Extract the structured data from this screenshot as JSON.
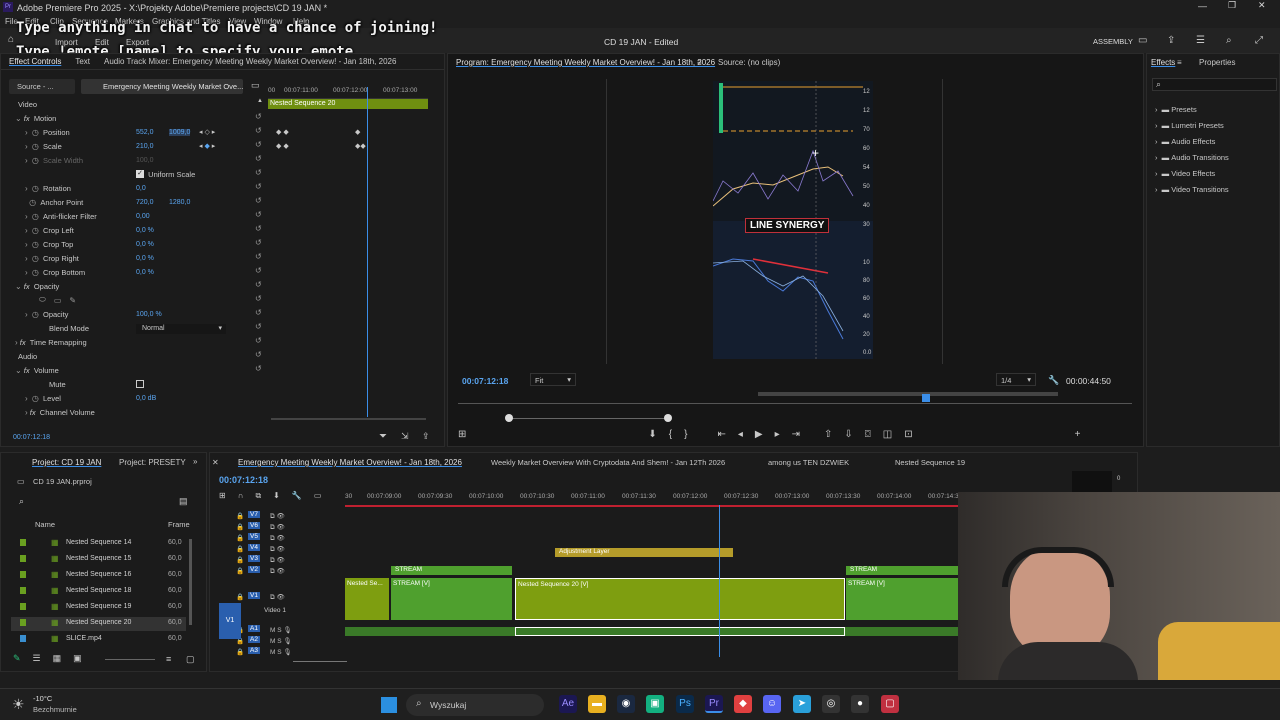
{
  "title_bar": {
    "title": "Adobe Premiere Pro 2025 - X:\\Projekty Adobe\\Premiere projects\\CD 19 JAN *"
  },
  "menu": [
    "File",
    "Edit",
    "Clip",
    "Sequence",
    "Markers",
    "Graphics and Titles",
    "View",
    "Window",
    "Help"
  ],
  "workspace": {
    "tabs": [
      "Import",
      "Edit",
      "Export"
    ],
    "center_title": "CD 19 JAN - Edited",
    "label": "ASSEMBLY"
  },
  "overlay": {
    "line1": "Type anything in chat to have a chance of joining!",
    "line2": "Type !emote [name] to specify your emote"
  },
  "effect_controls": {
    "tabs": [
      "Effect Controls",
      "Text",
      "Audio Track Mixer: Emergency Meeting Weekly Market Overview! - Jan 18th, 2026"
    ],
    "source_label": "Source - ...",
    "clip_label": "Emergency Meeting Weekly Market Ove...",
    "ruler": [
      "00",
      "00:07:11:00",
      "00:07:12:00",
      "00:07:13:00"
    ],
    "nested_label": "Nested Sequence 20",
    "video_header": "Video",
    "audio_header": "Audio",
    "motion": "Motion",
    "position": {
      "label": "Position",
      "x": "552,0",
      "y": "1009,0"
    },
    "scale": {
      "label": "Scale",
      "value": "210,0"
    },
    "scale_width": {
      "label": "Scale Width",
      "value": "100,0"
    },
    "uniform_scale": "Uniform Scale",
    "rotation": {
      "label": "Rotation",
      "value": "0,0"
    },
    "anchor": {
      "label": "Anchor Point",
      "x": "720,0",
      "y": "1280,0"
    },
    "antiflicker": {
      "label": "Anti-flicker Filter",
      "value": "0,00"
    },
    "crop_left": {
      "label": "Crop Left",
      "value": "0,0 %"
    },
    "crop_top": {
      "label": "Crop Top",
      "value": "0,0 %"
    },
    "crop_right": {
      "label": "Crop Right",
      "value": "0,0 %"
    },
    "crop_bottom": {
      "label": "Crop Bottom",
      "value": "0,0 %"
    },
    "opacity_group": "Opacity",
    "opacity": {
      "label": "Opacity",
      "value": "100,0 %"
    },
    "blend": {
      "label": "Blend Mode",
      "value": "Normal"
    },
    "time_remap": "Time Remapping",
    "volume": "Volume",
    "mute": "Mute",
    "level": {
      "label": "Level",
      "value": "0,0 dB"
    },
    "channel_volume": "Channel Volume",
    "timecode": "00:07:12:18"
  },
  "program": {
    "tab": "Program: Emergency Meeting Weekly Market Overview! - Jan 18th, 2026",
    "source_tab": "Source: (no clips)",
    "timecode": "00:07:12:18",
    "fit": "Fit",
    "resolution": "1/4",
    "duration": "00:00:44:50",
    "video_text": "LINE SYNERGY",
    "axis_top": [
      "12",
      "12",
      "70",
      "60",
      "54",
      "50",
      "40",
      "30"
    ],
    "axis_bottom": [
      "10",
      "80",
      "60",
      "40",
      "20",
      "0.0",
      "15"
    ]
  },
  "effects_panel": {
    "tabs": [
      "Effects",
      "Properties"
    ],
    "items": [
      "Presets",
      "Lumetri Presets",
      "Audio Effects",
      "Audio Transitions",
      "Video Effects",
      "Video Transitions"
    ]
  },
  "project": {
    "tabs": [
      "Project: CD 19 JAN",
      "Project: PRESETY"
    ],
    "file": "CD 19 JAN.prproj",
    "col_name": "Name",
    "col_frame": "Frame",
    "items": [
      {
        "name": "Nested Sequence 14",
        "fps": "60,0",
        "color": "#6aa020"
      },
      {
        "name": "Nested Sequence 15",
        "fps": "60,0",
        "color": "#6aa020"
      },
      {
        "name": "Nested Sequence 16",
        "fps": "60,0",
        "color": "#6aa020"
      },
      {
        "name": "Nested Sequence 18",
        "fps": "60,0",
        "color": "#6aa020"
      },
      {
        "name": "Nested Sequence 19",
        "fps": "60,0",
        "color": "#6aa020"
      },
      {
        "name": "Nested Sequence 20",
        "fps": "60,0",
        "color": "#6aa020"
      },
      {
        "name": "SLICE.mp4",
        "fps": "60,0",
        "color": "#3a8fd0"
      }
    ]
  },
  "timeline": {
    "tabs": [
      "Emergency Meeting Weekly Market Overview! - Jan 18th, 2026",
      "Weekly Market Overview With Cryptodata And Shem! - Jan 12Th 2026",
      "among us TEN DZWIEK",
      "Nested Sequence 19"
    ],
    "timecode": "00:07:12:18",
    "ruler": [
      "30",
      "00:07:09:00",
      "00:07:09:30",
      "00:07:10:00",
      "00:07:10:30",
      "00:07:11:00",
      "00:07:11:30",
      "00:07:12:00",
      "00:07:12:30",
      "00:07:13:00",
      "00:07:13:30",
      "00:07:14:00",
      "00:07:14:3"
    ],
    "tracks": [
      "V7",
      "V6",
      "V5",
      "V4",
      "V3",
      "V2",
      "V1",
      "A1",
      "A2",
      "A3"
    ],
    "track_name_v1": "Video 1",
    "clips": {
      "adjustment": "Adjustment Layer",
      "stream1": "STREAM",
      "stream1v": "STREAM [V]",
      "nested_se": "Nested Se...",
      "nested20": "Nested Sequence 20 [V]",
      "stream2": "STREAM",
      "stream2v": "STREAM [V]"
    },
    "meter_label": "0"
  },
  "taskbar": {
    "weather_temp": "-10°C",
    "weather_desc": "Bezchmurnie",
    "search": "Wyszukaj"
  }
}
